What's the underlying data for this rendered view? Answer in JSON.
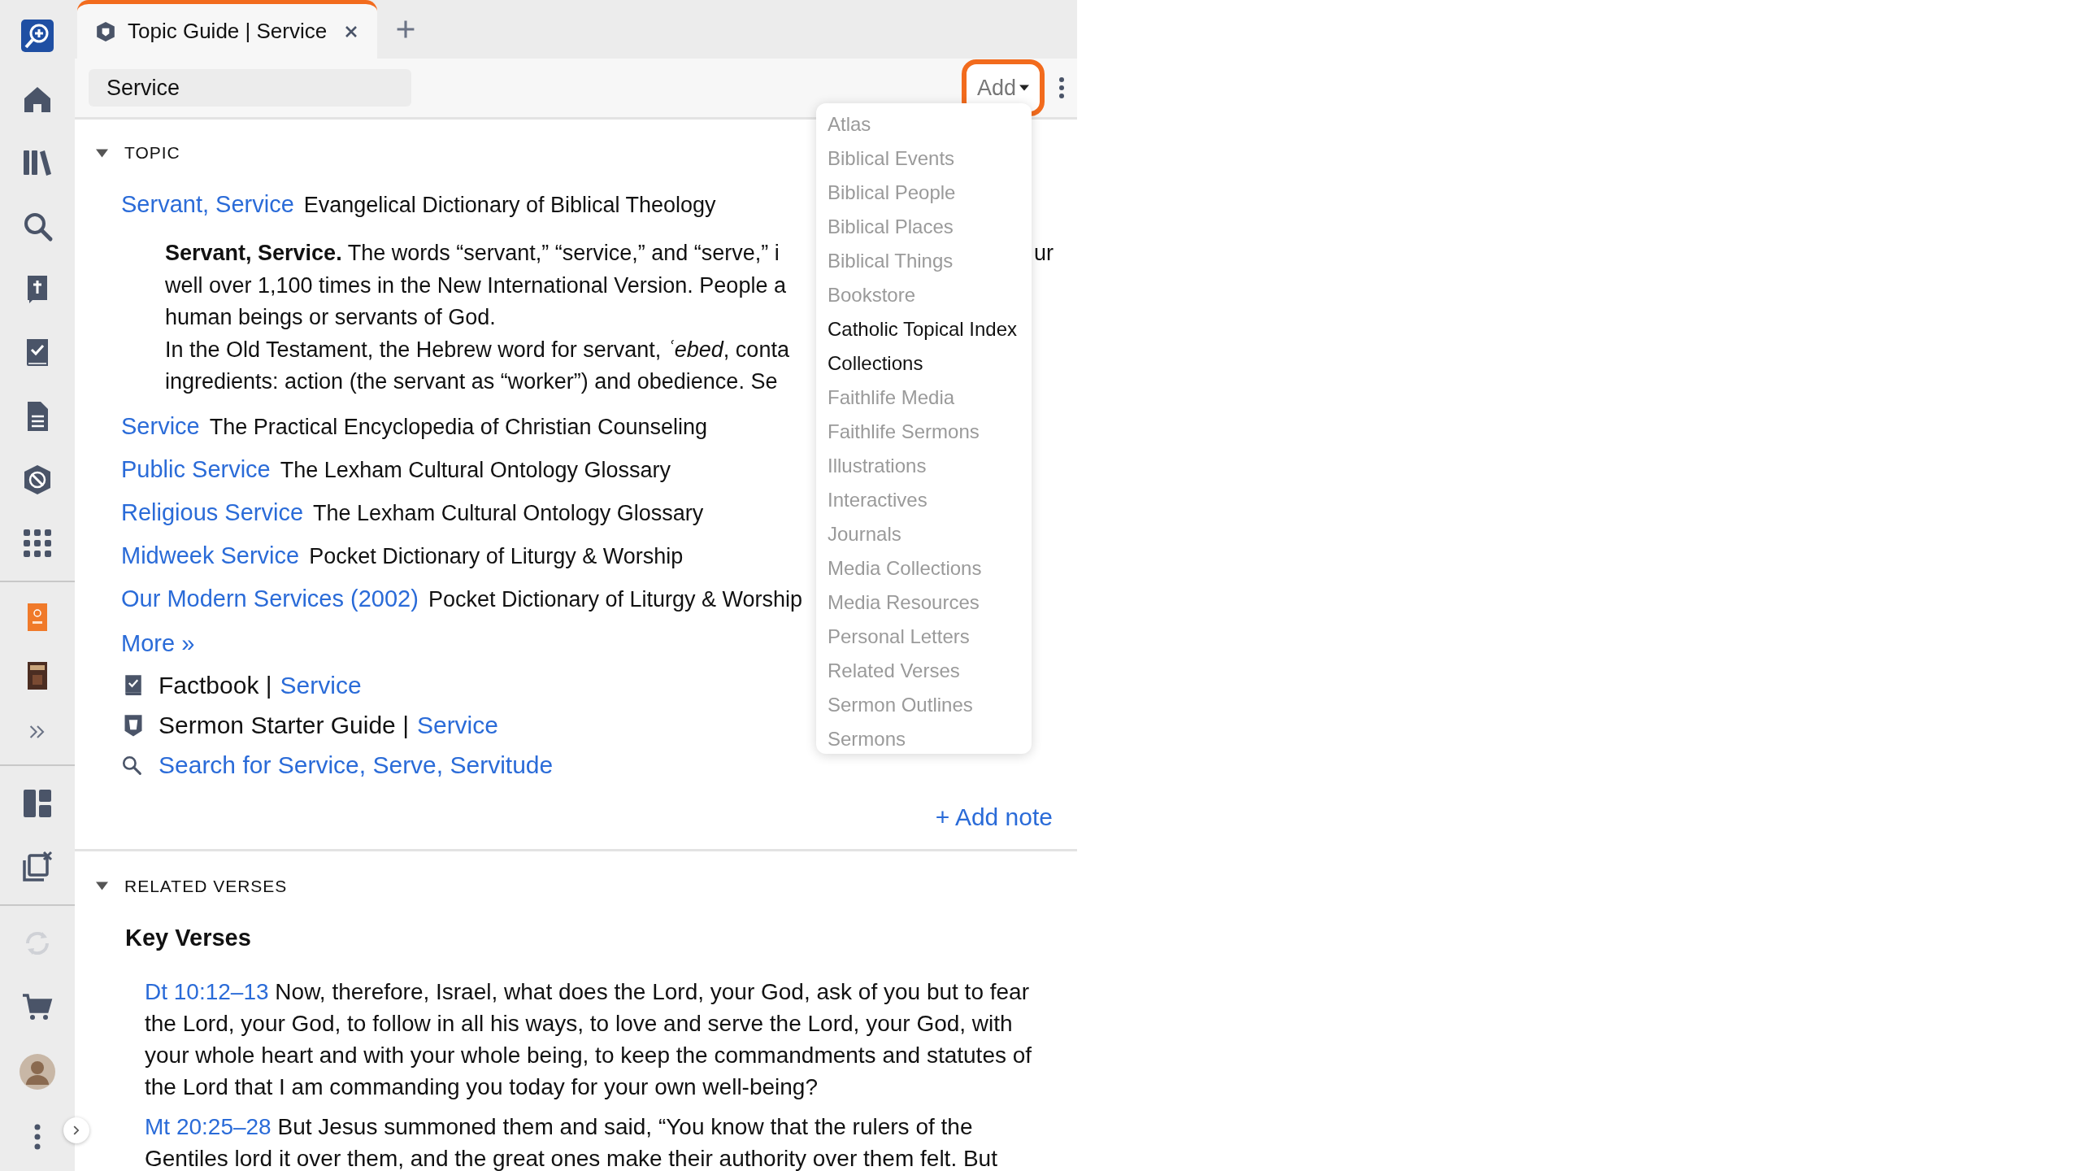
{
  "tabs": [
    {
      "title": "Topic Guide | Service",
      "selected": true
    }
  ],
  "toolbar": {
    "search_value": "Service",
    "add_button": "Add"
  },
  "add_menu": {
    "items": [
      {
        "label": "Atlas",
        "disabled": true
      },
      {
        "label": "Biblical Events",
        "disabled": true
      },
      {
        "label": "Biblical People",
        "disabled": true
      },
      {
        "label": "Biblical Places",
        "disabled": true
      },
      {
        "label": "Biblical Things",
        "disabled": true
      },
      {
        "label": "Bookstore",
        "disabled": true
      },
      {
        "label": "Catholic Topical Index",
        "disabled": false
      },
      {
        "label": "Collections",
        "disabled": false
      },
      {
        "label": "Faithlife Media",
        "disabled": true
      },
      {
        "label": "Faithlife Sermons",
        "disabled": true
      },
      {
        "label": "Illustrations",
        "disabled": true
      },
      {
        "label": "Interactives",
        "disabled": true
      },
      {
        "label": "Journals",
        "disabled": true
      },
      {
        "label": "Media Collections",
        "disabled": true
      },
      {
        "label": "Media Resources",
        "disabled": true
      },
      {
        "label": "Personal Letters",
        "disabled": true
      },
      {
        "label": "Related Verses",
        "disabled": true
      },
      {
        "label": "Sermon Outlines",
        "disabled": true
      },
      {
        "label": "Sermons",
        "disabled": true
      }
    ]
  },
  "topic": {
    "heading": "TOPIC",
    "expanded": true,
    "articles": [
      {
        "title": "Servant, Service",
        "source": "Evangelical Dictionary of Biblical Theology",
        "excerpt": [
          {
            "text": "**Servant, Service.** The words “servant,” “service,” and “serve,” i",
            "tail": "ur"
          },
          {
            "text": "well over 1,100 times in the New International Version. People a"
          },
          {
            "text": "human beings or servants of God."
          },
          {
            "text": "In the Old Testament, the Hebrew word for servant, *ʿebed*, conta"
          },
          {
            "text": "ingredients: action (the servant as “worker”) and obedience. Se"
          }
        ]
      },
      {
        "title": "Service",
        "source": "The Practical Encyclopedia of Christian Counseling"
      },
      {
        "title": "Public Service",
        "source": "The Lexham Cultural Ontology Glossary"
      },
      {
        "title": "Religious Service",
        "source": "The Lexham Cultural Ontology Glossary"
      },
      {
        "title": "Midweek Service",
        "source": "Pocket Dictionary of Liturgy & Worship"
      },
      {
        "title": "Our Modern Services (2002)",
        "source": "Pocket Dictionary of Liturgy & Worship"
      }
    ],
    "more": "More »",
    "guides": [
      {
        "kind": "factbook",
        "name": "Factbook |",
        "link": "Service"
      },
      {
        "kind": "sermon",
        "name": "Sermon Starter Guide |",
        "link": "Service"
      }
    ],
    "search_link": "Search for Service, Serve, Servitude",
    "add_note": "+ Add note"
  },
  "related_verses": {
    "heading": "RELATED VERSES",
    "expanded": true,
    "subheading": "Key Verses",
    "verses": [
      {
        "ref": "Dt 10:12–13",
        "text": "Now, therefore, Israel, what does the Lord, your God, ask of you but to fear the Lord, your God, to follow in all his ways, to love and serve the Lord, your God, with your whole heart and with your whole being, to keep the commandments and statutes of the Lord that I am commanding you today for your own well-being?"
      },
      {
        "ref": "Mt 20:25–28",
        "text": "But Jesus summoned them and said, “You know that the rulers of the Gentiles lord it over them, and the great ones make their authority over them felt. But"
      }
    ]
  }
}
